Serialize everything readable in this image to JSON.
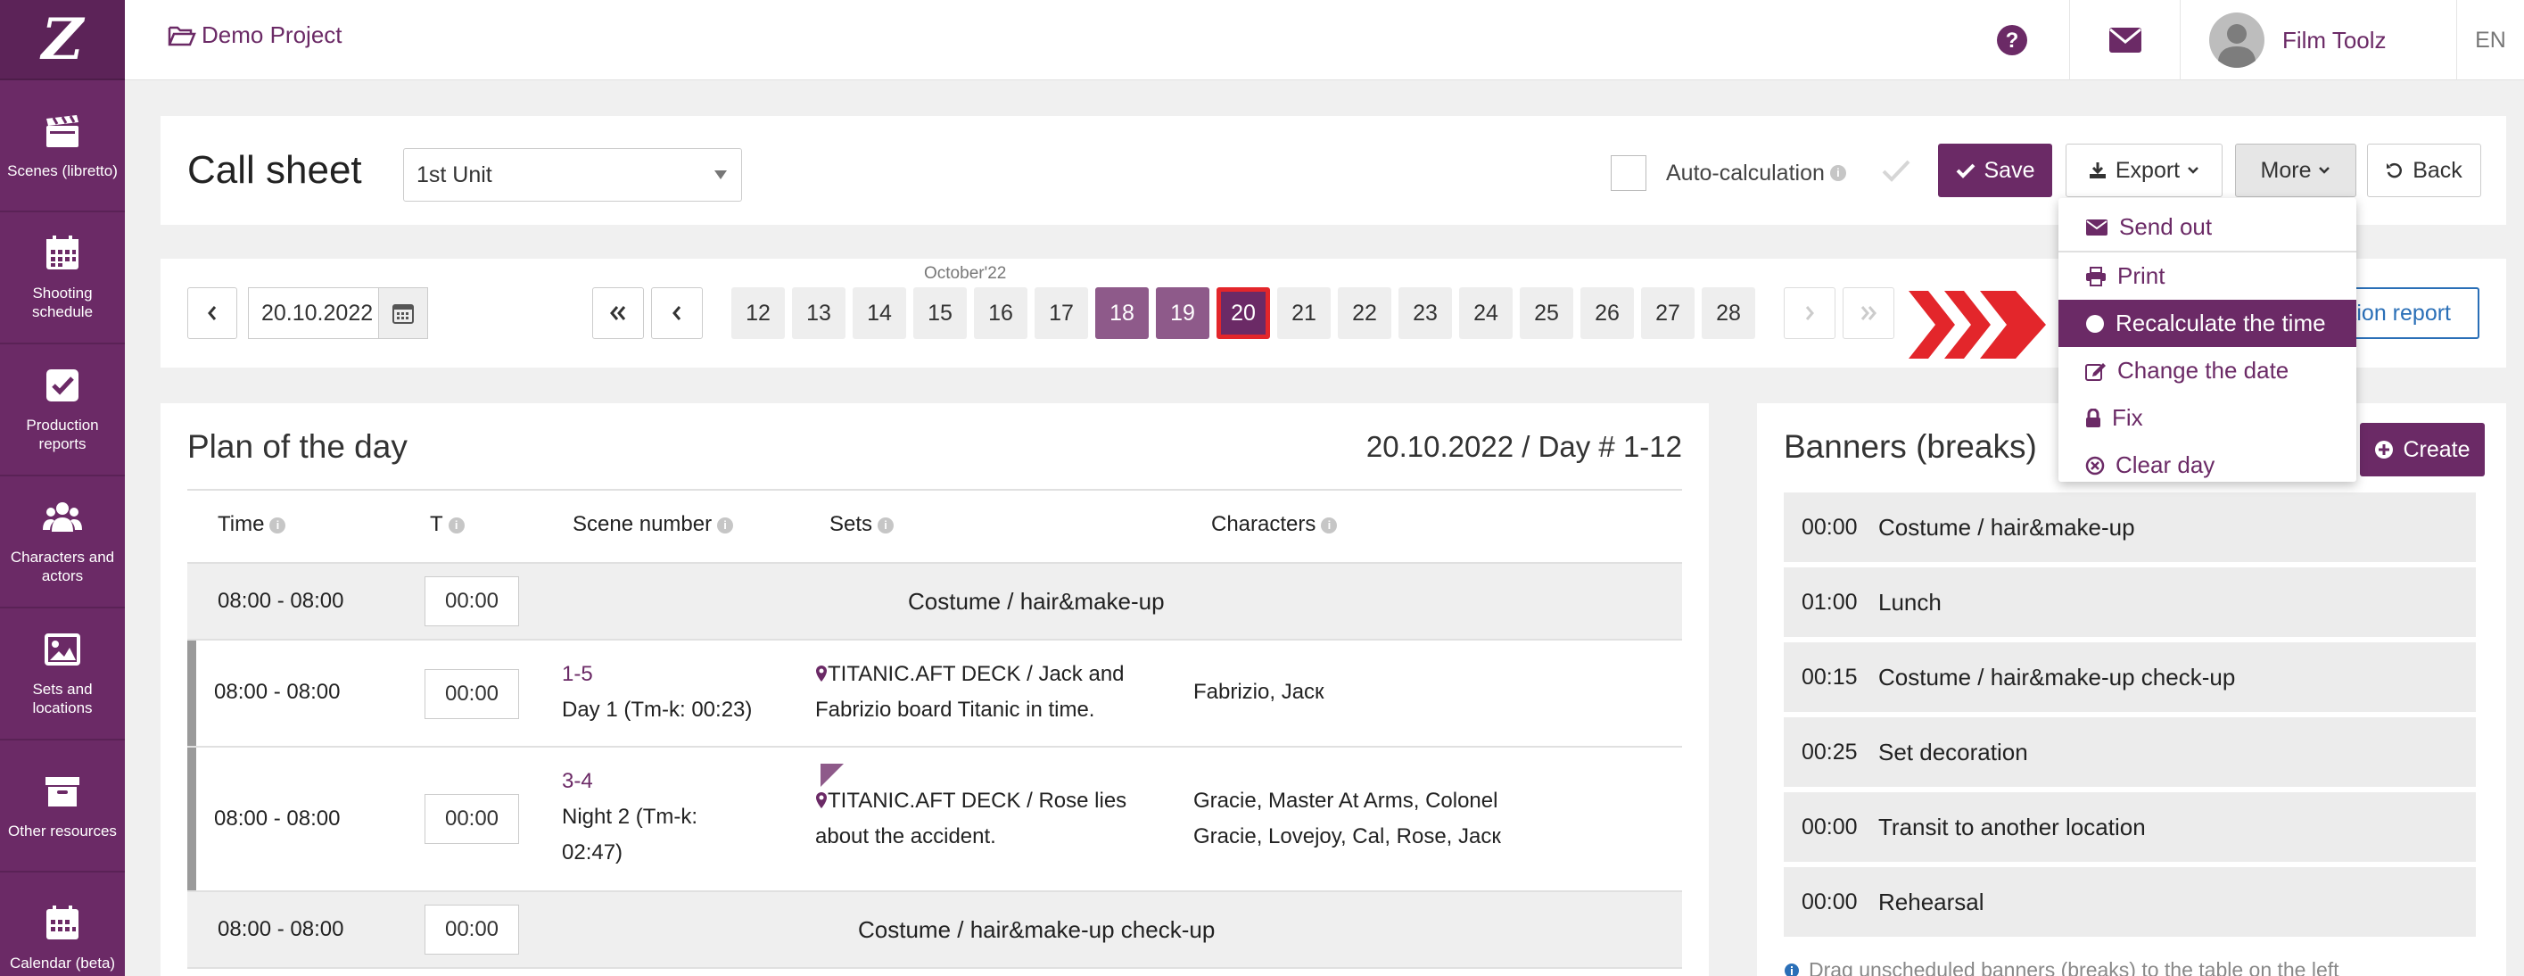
{
  "sidebar": {
    "logo": "Z",
    "items": [
      {
        "label": "Scenes (libretto)",
        "icon": "clapperboard-icon"
      },
      {
        "label": "Shooting schedule",
        "icon": "calendar-grid-icon"
      },
      {
        "label": "Production reports",
        "icon": "checkbox-icon"
      },
      {
        "label": "Characters and actors",
        "icon": "users-icon"
      },
      {
        "label": "Sets and locations",
        "icon": "picture-icon"
      },
      {
        "label": "Other resources",
        "icon": "archive-box-icon"
      },
      {
        "label": "Calendar (beta)",
        "icon": "calendar-icon"
      }
    ]
  },
  "topbar": {
    "project": "Demo Project",
    "user_name": "Film Toolz",
    "language": "EN",
    "icons": [
      "help-icon",
      "mail-icon",
      "avatar"
    ]
  },
  "header": {
    "title": "Call sheet",
    "unit_select": "1st Unit",
    "auto_calc_label": "Auto-calculation",
    "save_label": "Save",
    "export_label": "Export",
    "more_label": "More",
    "back_label": "Back"
  },
  "more_menu": {
    "items": [
      {
        "label": "Send out",
        "icon": "envelope-icon"
      },
      {
        "label": "Print",
        "icon": "print-icon"
      },
      {
        "label": "Recalculate the time",
        "icon": "circle-icon",
        "active": true
      },
      {
        "label": "Change the date",
        "icon": "edit-icon"
      },
      {
        "label": "Fix",
        "icon": "lock-icon"
      },
      {
        "label": "Clear day",
        "icon": "times-circle-icon"
      }
    ]
  },
  "date_nav": {
    "date_value": "20.10.2022",
    "month_label": "October'22",
    "days": [
      "12",
      "13",
      "14",
      "15",
      "16",
      "17",
      "18",
      "19",
      "20",
      "21",
      "22",
      "23",
      "24",
      "25",
      "26",
      "27",
      "28"
    ],
    "selected_days": [
      "18",
      "19"
    ],
    "current_day": "20",
    "report_label": "Production report"
  },
  "plan": {
    "title": "Plan of the day",
    "day_info": "20.10.2022 / Day # 1-12",
    "columns": [
      "Time",
      "T",
      "Scene number",
      "Sets",
      "Characters"
    ],
    "rows": [
      {
        "time": "08:00 - 08:00",
        "t": "00:00",
        "banner": "Costume / hair&make-up"
      },
      {
        "time": "08:00 - 08:00",
        "t": "00:00",
        "scene": "1-5",
        "scene_desc": "Day 1 (Tm-k: 00:23)",
        "set_line1": "TITANIC.AFT DECK / Jack and",
        "set_line2": "Fabrizio board Titanic in time.",
        "chars_line1": "Fabrizio, Jacк",
        "chars_line2": ""
      },
      {
        "time": "08:00 - 08:00",
        "t": "00:00",
        "scene": "3-4",
        "scene_desc_line1": "Night 2 (Tm-k:",
        "scene_desc_line2": "02:47)",
        "set_line1": "TITANIC.AFT DECK / Rose lies",
        "set_line2": "about the accident.",
        "chars_line1": "Gracie, Master At Arms, Colonel",
        "chars_line2": "Gracie, Lovejoy, Cal, Rose, Jacк"
      },
      {
        "time": "08:00 - 08:00",
        "t": "00:00",
        "banner": "Costume / hair&make-up check-up"
      }
    ]
  },
  "banners": {
    "title": "Banners (breaks)",
    "create_label": "Create",
    "items": [
      {
        "time": "00:00",
        "name": "Costume / hair&make-up"
      },
      {
        "time": "01:00",
        "name": "Lunch"
      },
      {
        "time": "00:15",
        "name": "Costume / hair&make-up check-up"
      },
      {
        "time": "00:25",
        "name": "Set decoration"
      },
      {
        "time": "00:00",
        "name": "Transit to another location"
      },
      {
        "time": "00:00",
        "name": "Rehearsal"
      }
    ],
    "hint": "Drag unscheduled banners (breaks) to the table on the left"
  },
  "colors": {
    "brand": "#6b2a66",
    "highlight_border": "#e3262b",
    "arrow": "#e3262b",
    "link": "#2a6fb7"
  }
}
